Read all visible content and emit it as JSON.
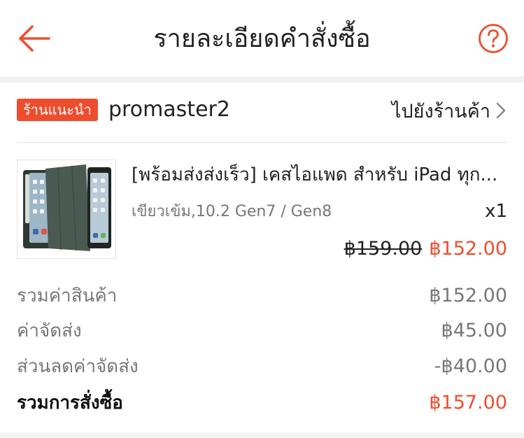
{
  "header": {
    "title": "รายละเอียดคำสั่งซื้อ",
    "back_icon": "arrow-left-icon",
    "help_icon": "question-circle-icon"
  },
  "shop": {
    "badge": "ร้านแนะนำ",
    "name": "promaster2",
    "go_to_shop": "ไปยังร้านค้า"
  },
  "product": {
    "title": "[พร้อมส่งส่งเร็ว] เคสไอแพด สำหรับ iPad ทุก...",
    "variant": "เขียวเข้ม,10.2 Gen7 / Gen8",
    "quantity": "x1",
    "original_price": "฿159.00",
    "price": "฿152.00"
  },
  "summary": [
    {
      "label": "รวมค่าสินค้า",
      "value": "฿152.00"
    },
    {
      "label": "ค่าจัดส่ง",
      "value": "฿45.00"
    },
    {
      "label": "ส่วนลดค่าจัดส่ง",
      "value": "-฿40.00"
    },
    {
      "label": "รวมการสั่งซื้อ",
      "value": "฿157.00"
    }
  ],
  "colors": {
    "accent": "#ee4d2d",
    "text": "#222222",
    "muted": "#777777",
    "case_green": "#4a5a52"
  }
}
